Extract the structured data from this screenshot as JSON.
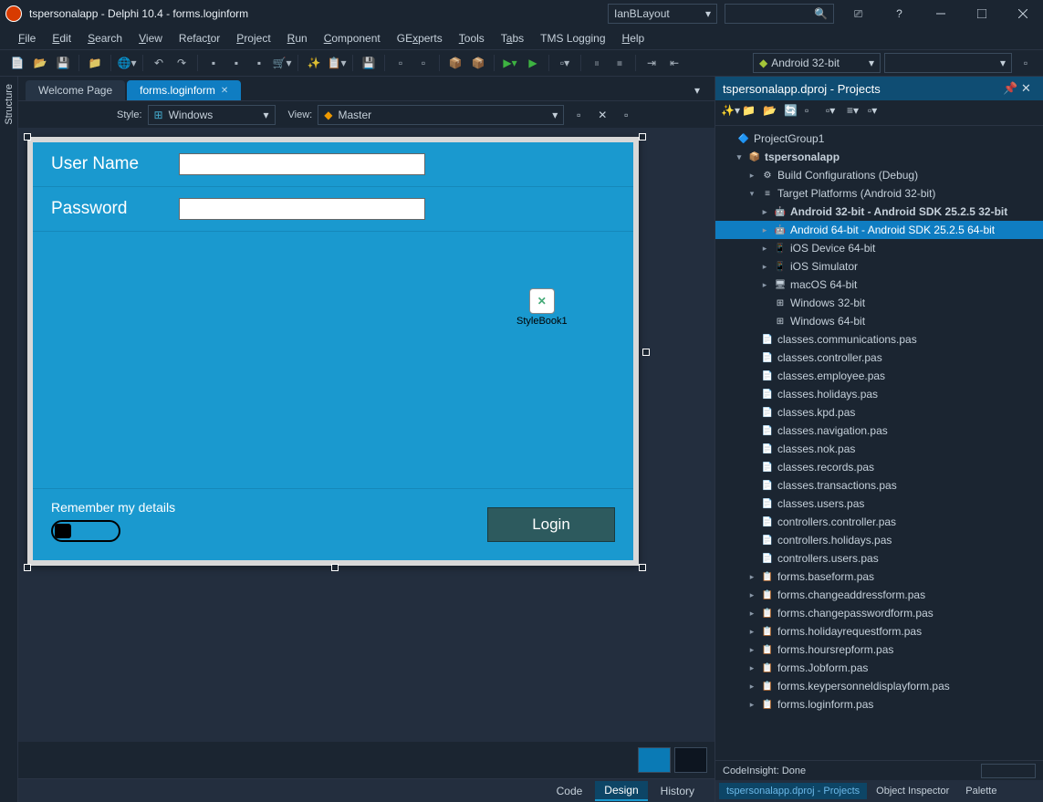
{
  "title": "tspersonalapp - Delphi 10.4 - forms.loginform",
  "layout_combo": "IanBLayout",
  "menu": [
    "File",
    "Edit",
    "Search",
    "View",
    "Refactor",
    "Project",
    "Run",
    "Component",
    "GExperts",
    "Tools",
    "Tabs",
    "TMS Logging",
    "Help"
  ],
  "platform_combo": "Android 32-bit",
  "structure_label": "Structure",
  "tabs": [
    {
      "label": "Welcome Page",
      "active": false
    },
    {
      "label": "forms.loginform",
      "active": true
    }
  ],
  "style_label": "Style:",
  "style_value": "Windows",
  "view_label": "View:",
  "view_value": "Master",
  "form": {
    "username_label": "User Name",
    "password_label": "Password",
    "stylebook_caption": "StyleBook1",
    "remember_label": "Remember my details",
    "login_button": "Login"
  },
  "bottom_tabs": [
    "Code",
    "Design",
    "History"
  ],
  "bottom_tab_active": "Design",
  "projects": {
    "title": "tspersonalapp.dproj - Projects",
    "codeinsight": "CodeInsight: Done",
    "tabs": [
      "tspersonalapp.dproj - Projects",
      "Object Inspector",
      "Palette"
    ],
    "tree": [
      {
        "d": 0,
        "tw": "",
        "ic": "grp",
        "txt": "ProjectGroup1"
      },
      {
        "d": 1,
        "tw": "▾",
        "ic": "prj",
        "txt": "tspersonalapp",
        "bold": true
      },
      {
        "d": 2,
        "tw": "▸",
        "ic": "cfg",
        "txt": "Build Configurations (Debug)"
      },
      {
        "d": 2,
        "tw": "▾",
        "ic": "tgt",
        "txt": "Target Platforms (Android 32-bit)"
      },
      {
        "d": 3,
        "tw": "▸",
        "ic": "and",
        "txt": "Android 32-bit - Android SDK 25.2.5 32-bit",
        "bold": true
      },
      {
        "d": 3,
        "tw": "▸",
        "ic": "and",
        "txt": "Android 64-bit - Android SDK 25.2.5 64-bit",
        "sel": true
      },
      {
        "d": 3,
        "tw": "▸",
        "ic": "ios",
        "txt": "iOS Device 64-bit"
      },
      {
        "d": 3,
        "tw": "▸",
        "ic": "ios",
        "txt": "iOS Simulator"
      },
      {
        "d": 3,
        "tw": "▸",
        "ic": "mac",
        "txt": "macOS 64-bit"
      },
      {
        "d": 3,
        "tw": "",
        "ic": "win",
        "txt": "Windows 32-bit"
      },
      {
        "d": 3,
        "tw": "",
        "ic": "win",
        "txt": "Windows 64-bit"
      },
      {
        "d": 2,
        "tw": "",
        "ic": "pas",
        "txt": "classes.communications.pas"
      },
      {
        "d": 2,
        "tw": "",
        "ic": "pas",
        "txt": "classes.controller.pas"
      },
      {
        "d": 2,
        "tw": "",
        "ic": "pas",
        "txt": "classes.employee.pas"
      },
      {
        "d": 2,
        "tw": "",
        "ic": "pas",
        "txt": "classes.holidays.pas"
      },
      {
        "d": 2,
        "tw": "",
        "ic": "pas",
        "txt": "classes.kpd.pas"
      },
      {
        "d": 2,
        "tw": "",
        "ic": "pas",
        "txt": "classes.navigation.pas"
      },
      {
        "d": 2,
        "tw": "",
        "ic": "pas",
        "txt": "classes.nok.pas"
      },
      {
        "d": 2,
        "tw": "",
        "ic": "pas",
        "txt": "classes.records.pas"
      },
      {
        "d": 2,
        "tw": "",
        "ic": "pas",
        "txt": "classes.transactions.pas"
      },
      {
        "d": 2,
        "tw": "",
        "ic": "pas",
        "txt": "classes.users.pas"
      },
      {
        "d": 2,
        "tw": "",
        "ic": "pas",
        "txt": "controllers.controller.pas"
      },
      {
        "d": 2,
        "tw": "",
        "ic": "pas",
        "txt": "controllers.holidays.pas"
      },
      {
        "d": 2,
        "tw": "",
        "ic": "pas",
        "txt": "controllers.users.pas"
      },
      {
        "d": 2,
        "tw": "▸",
        "ic": "frm",
        "txt": "forms.baseform.pas"
      },
      {
        "d": 2,
        "tw": "▸",
        "ic": "frm",
        "txt": "forms.changeaddressform.pas"
      },
      {
        "d": 2,
        "tw": "▸",
        "ic": "frm",
        "txt": "forms.changepasswordform.pas"
      },
      {
        "d": 2,
        "tw": "▸",
        "ic": "frm",
        "txt": "forms.holidayrequestform.pas"
      },
      {
        "d": 2,
        "tw": "▸",
        "ic": "frm",
        "txt": "forms.hoursrepform.pas"
      },
      {
        "d": 2,
        "tw": "▸",
        "ic": "frm",
        "txt": "forms.Jobform.pas"
      },
      {
        "d": 2,
        "tw": "▸",
        "ic": "frm",
        "txt": "forms.keypersonneldisplayform.pas"
      },
      {
        "d": 2,
        "tw": "▸",
        "ic": "frm",
        "txt": "forms.loginform.pas"
      }
    ]
  }
}
